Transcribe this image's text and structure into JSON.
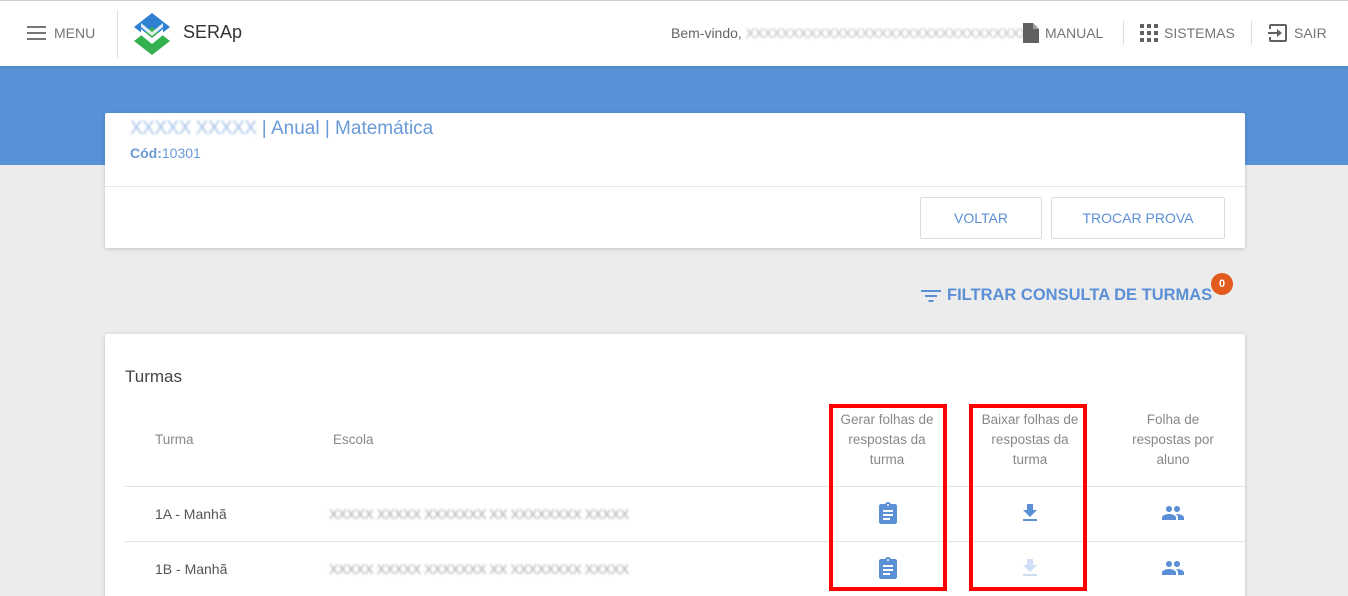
{
  "header": {
    "menu_label": "MENU",
    "app_title": "SERAp",
    "welcome_prefix": "Bem-vindo,",
    "welcome_user": "XXXXXXXXXXXXXXXXXXXXXXXXXXXXXXXX",
    "manual_label": "MANUAL",
    "sistemas_label": "SISTEMAS",
    "sair_label": "SAIR"
  },
  "test": {
    "name_redacted": "XXXXX XXXXX",
    "title_suffix": " | Anual | Matemática",
    "cod_label": "Cód:",
    "cod_value": "10301",
    "back_label": "VOLTAR",
    "change_label": "TROCAR PROVA"
  },
  "filter": {
    "label": "FILTRAR CONSULTA DE TURMAS",
    "count": "0"
  },
  "turmas": {
    "title": "Turmas",
    "columns": {
      "turma": "Turma",
      "escola": "Escola",
      "gerar_l1": "Gerar folhas de",
      "gerar_l2": "respostas da",
      "gerar_l3": "turma",
      "baixar_l1": "Baixar folhas de",
      "baixar_l2": "respostas da",
      "baixar_l3": "turma",
      "aluno_l1": "Folha de",
      "aluno_l2": "respostas por",
      "aluno_l3": "aluno"
    },
    "rows": [
      {
        "turma": "1A - Manhã",
        "escola": "XXXXX XXXXX XXXXXXX XX XXXXXXXX XXXXX",
        "download_enabled": true
      },
      {
        "turma": "1B - Manhã",
        "escola": "XXXXX XXXXX XXXXXXX XX XXXXXXXX XXXXX",
        "download_enabled": false
      }
    ]
  },
  "colors": {
    "primary": "#5b8fd6",
    "banner": "#5792d7",
    "badge": "#e25a1c",
    "highlight": "#ff0000"
  },
  "icons": [
    "menu-icon",
    "logo-icon",
    "document-icon",
    "apps-grid-icon",
    "exit-icon",
    "filter-icon",
    "clipboard-icon",
    "download-icon",
    "people-icon"
  ]
}
